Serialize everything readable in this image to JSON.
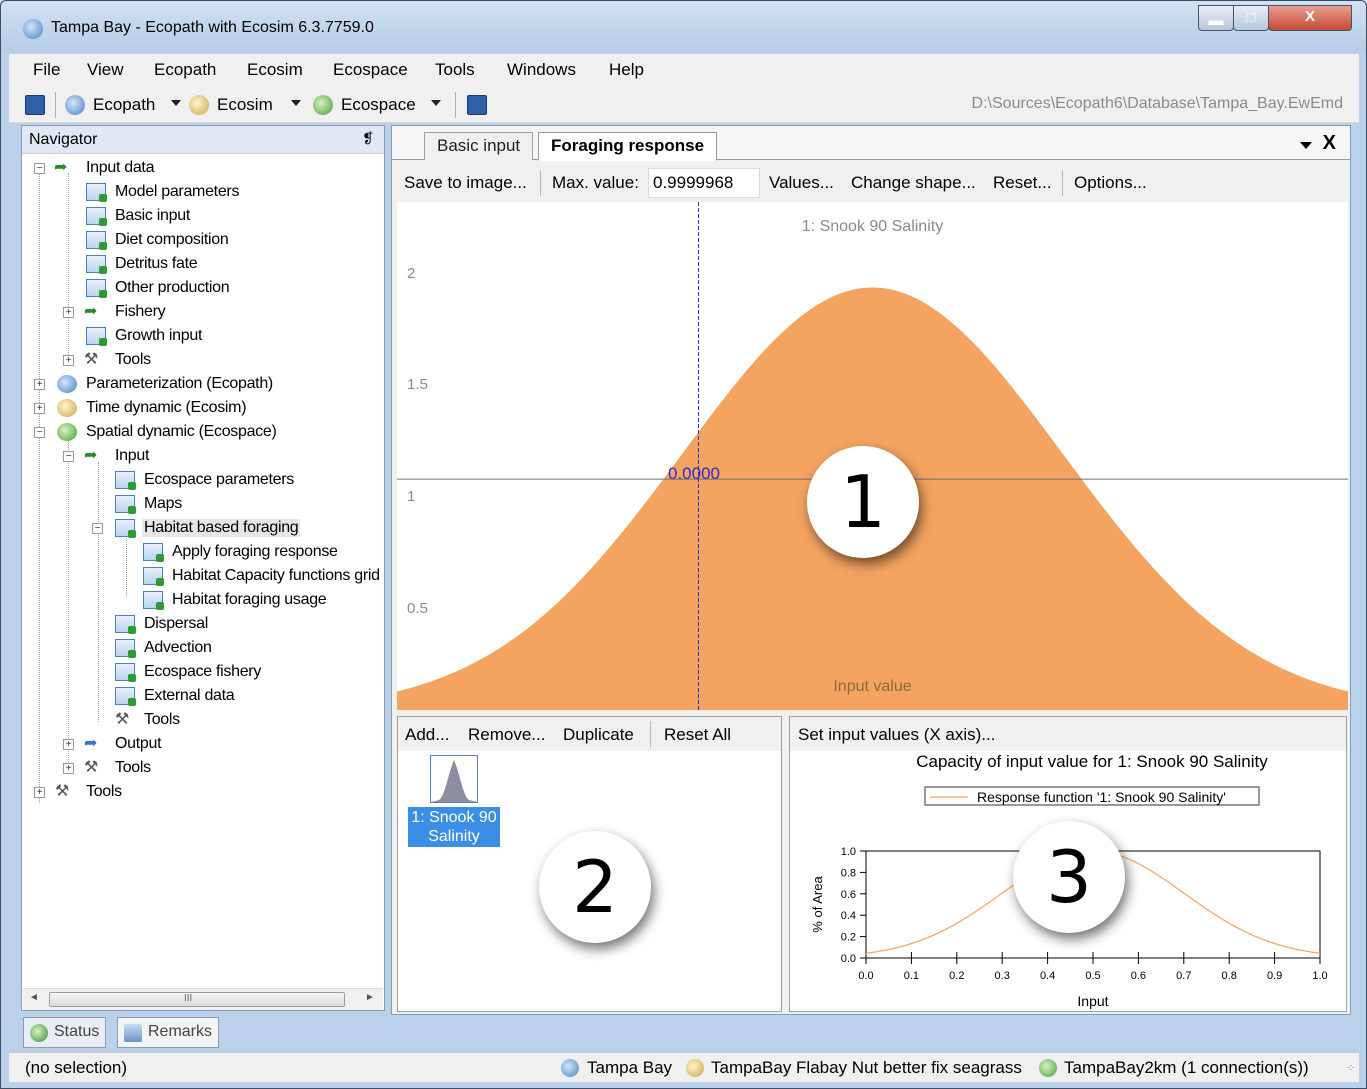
{
  "window": {
    "title": "Tampa Bay - Ecopath with Ecosim 6.3.7759.0",
    "close_glyph": "X"
  },
  "menu": [
    "File",
    "View",
    "Ecopath",
    "Ecosim",
    "Ecospace",
    "Tools",
    "Windows",
    "Help"
  ],
  "toolbar": {
    "ecopath_label": "Ecopath",
    "ecosim_label": "Ecosim",
    "ecospace_label": "Ecospace",
    "file_path": "D:\\Sources\\Ecopath6\\Database\\Tampa_Bay.EwEmd"
  },
  "navigator": {
    "title": "Navigator",
    "pin_glyph": "❡",
    "items": [
      {
        "label": "Input data"
      },
      {
        "label": "Model parameters"
      },
      {
        "label": "Basic input"
      },
      {
        "label": "Diet composition"
      },
      {
        "label": "Detritus fate"
      },
      {
        "label": "Other production"
      },
      {
        "label": "Fishery"
      },
      {
        "label": "Growth input"
      },
      {
        "label": "Tools"
      },
      {
        "label": "Parameterization (Ecopath)"
      },
      {
        "label": "Time dynamic (Ecosim)"
      },
      {
        "label": "Spatial dynamic  (Ecospace)"
      },
      {
        "label": "Input"
      },
      {
        "label": "Ecospace parameters"
      },
      {
        "label": "Maps"
      },
      {
        "label": "Habitat based foraging"
      },
      {
        "label": "Apply foraging response"
      },
      {
        "label": "Habitat Capacity functions grid"
      },
      {
        "label": "Habitat foraging usage"
      },
      {
        "label": "Dispersal"
      },
      {
        "label": "Advection"
      },
      {
        "label": "Ecospace fishery"
      },
      {
        "label": "External data"
      },
      {
        "label": "Tools"
      },
      {
        "label": "Output"
      },
      {
        "label": "Tools"
      },
      {
        "label": "Tools"
      }
    ],
    "scroll_grip": "III",
    "scroll_left": "◄",
    "scroll_right": "►"
  },
  "left_tabs": {
    "status": "Status",
    "remarks": "Remarks"
  },
  "tabs": {
    "basic_input": "Basic input",
    "foraging_response": "Foraging response"
  },
  "chart_toolbar": {
    "save_to_image": "Save to image...",
    "max_value_label": "Max. value:",
    "max_value": "0.9999968",
    "values": "Values...",
    "change_shape": "Change shape...",
    "reset": "Reset...",
    "options": "Options..."
  },
  "main_chart": {
    "title": "1: Snook 90 Salinity",
    "xlabel": "Input value",
    "y_ticks": [
      "2",
      "1.5",
      "1",
      "0.5"
    ],
    "cursor_readout": "0.0000",
    "fill_color": "#f4a460"
  },
  "shapes_panel": {
    "add": "Add...",
    "remove": "Remove...",
    "duplicate": "Duplicate",
    "reset_all": "Reset All",
    "item_label": "1: Snook 90 Salinity"
  },
  "capacity_panel": {
    "set_input_values": "Set input values (X axis)..."
  },
  "chart_data": [
    {
      "type": "area",
      "title": "1: Snook 90 Salinity",
      "xlabel": "Input value",
      "ylabel": "",
      "ylim": [
        0,
        2.2
      ],
      "xlim": [
        0,
        1
      ],
      "peak_x": 0.5,
      "peak_y": 1.83,
      "reference_line_y": 1,
      "cursor_x": 0.317,
      "x": [
        0,
        0.05,
        0.1,
        0.15,
        0.2,
        0.25,
        0.3,
        0.35,
        0.4,
        0.45,
        0.5,
        0.55,
        0.6,
        0.65,
        0.7,
        0.75,
        0.8,
        0.85,
        0.9,
        0.95,
        1.0
      ],
      "values": [
        0.02,
        0.06,
        0.13,
        0.24,
        0.4,
        0.62,
        0.89,
        1.18,
        1.46,
        1.7,
        1.83,
        1.83,
        1.7,
        1.46,
        1.18,
        0.89,
        0.62,
        0.4,
        0.24,
        0.13,
        0.02
      ]
    },
    {
      "type": "line",
      "title": "Capacity of input value for 1: Snook 90 Salinity",
      "xlabel": "Input",
      "ylabel": "% of Area",
      "legend": "Response function '1: Snook 90 Salinity'",
      "legend_position": "top",
      "xlim": [
        0,
        1
      ],
      "ylim": [
        0,
        1
      ],
      "x_ticks": [
        "0.0",
        "0.1",
        "0.2",
        "0.3",
        "0.4",
        "0.5",
        "0.6",
        "0.7",
        "0.8",
        "0.9",
        "1.0"
      ],
      "y_ticks": [
        "1.0",
        "0.8",
        "0.6",
        "0.4",
        "0.2",
        "0.0"
      ],
      "x": [
        0,
        0.1,
        0.2,
        0.3,
        0.35,
        0.4,
        0.45,
        0.5,
        0.55,
        0.6,
        0.65,
        0.7,
        0.8,
        0.9,
        1.0
      ],
      "values": [
        0.01,
        0.06,
        0.22,
        0.49,
        0.65,
        0.81,
        0.94,
        1.0,
        0.94,
        0.81,
        0.65,
        0.49,
        0.22,
        0.06,
        0.01
      ],
      "color": "#f4a460"
    }
  ],
  "annotations": [
    "1",
    "2",
    "3"
  ],
  "statusbar": {
    "selection": "(no selection)",
    "ecopath_model": "Tampa Bay",
    "ecosim_scenario": "TampaBay Flabay Nut better fix seagrass",
    "ecospace_scenario": "TampaBay2km (1 connection(s))"
  }
}
